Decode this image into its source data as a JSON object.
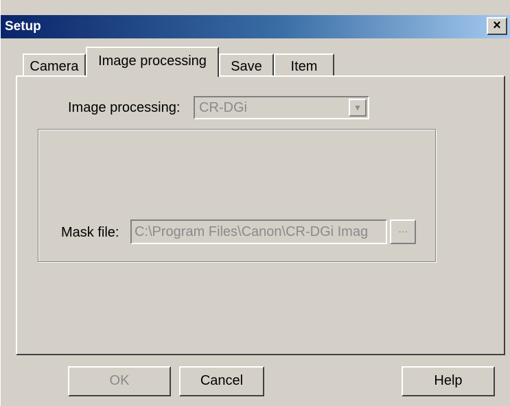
{
  "window": {
    "title": "Setup",
    "close_glyph": "×"
  },
  "tabs": [
    {
      "label": "Camera"
    },
    {
      "label": "Image processing",
      "active": true
    },
    {
      "label": "Save"
    },
    {
      "label": "Item"
    }
  ],
  "image_processing": {
    "label": "Image processing:",
    "selected": "CR-DGi",
    "arrow_icon": "chevron-down-icon",
    "arrow_glyph": "▼"
  },
  "mask": {
    "label": "Mask file:",
    "value": "C:\\Program Files\\Canon\\CR-DGi Imag",
    "browse_label": "..."
  },
  "buttons": {
    "ok": "OK",
    "cancel": "Cancel",
    "help": "Help"
  },
  "colors": {
    "face": "#d4d0c8",
    "titlebar_start": "#0a246a",
    "titlebar_end": "#a6caf0",
    "disabled_text": "#8a8a8a"
  }
}
